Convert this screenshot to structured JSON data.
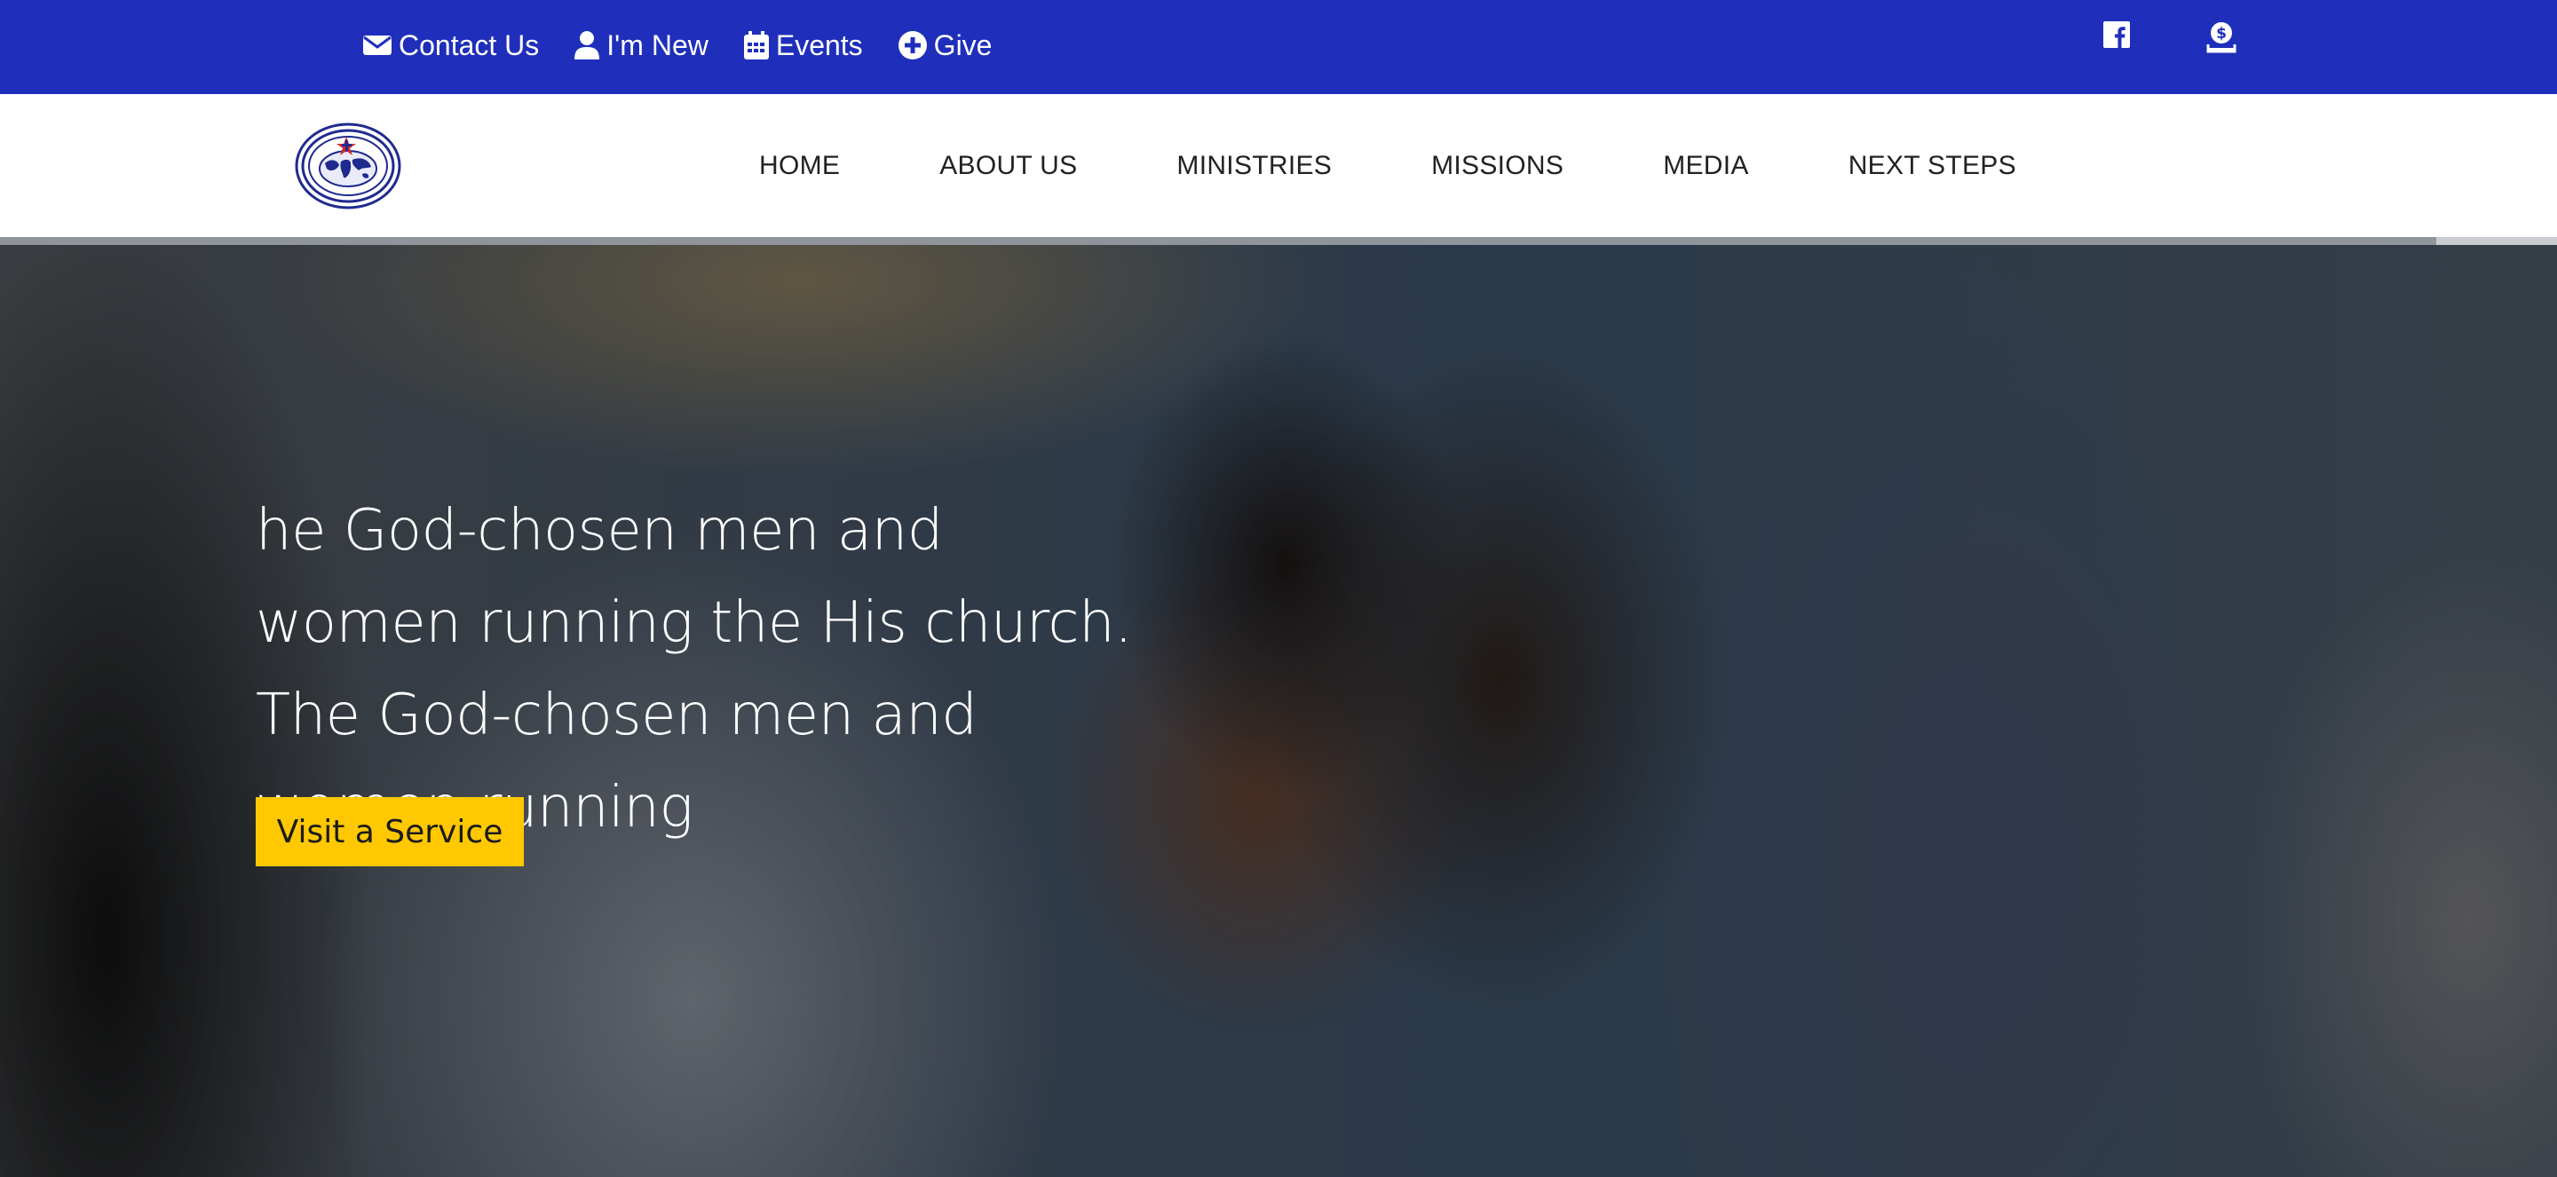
{
  "topbar": {
    "background": "#1f2fbb",
    "links": [
      {
        "label": "Contact Us",
        "icon": "envelope-icon"
      },
      {
        "label": "I'm New",
        "icon": "user-icon"
      },
      {
        "label": "Events",
        "icon": "calendar-icon"
      },
      {
        "label": "Give",
        "icon": "plus-circle-icon"
      }
    ],
    "social": [
      {
        "icon": "facebook-icon"
      },
      {
        "icon": "donate-icon"
      }
    ]
  },
  "nav": {
    "logo_icon": "church-logo-globe",
    "items": [
      "HOME",
      "ABOUT US",
      "MINISTRIES",
      "MISSIONS",
      "MEDIA",
      "NEXT STEPS"
    ]
  },
  "hero": {
    "text": "he God-chosen men and women running the His church. The God-chosen men and women running",
    "button_label": "Visit a Service",
    "button_color": "#ffc800"
  }
}
